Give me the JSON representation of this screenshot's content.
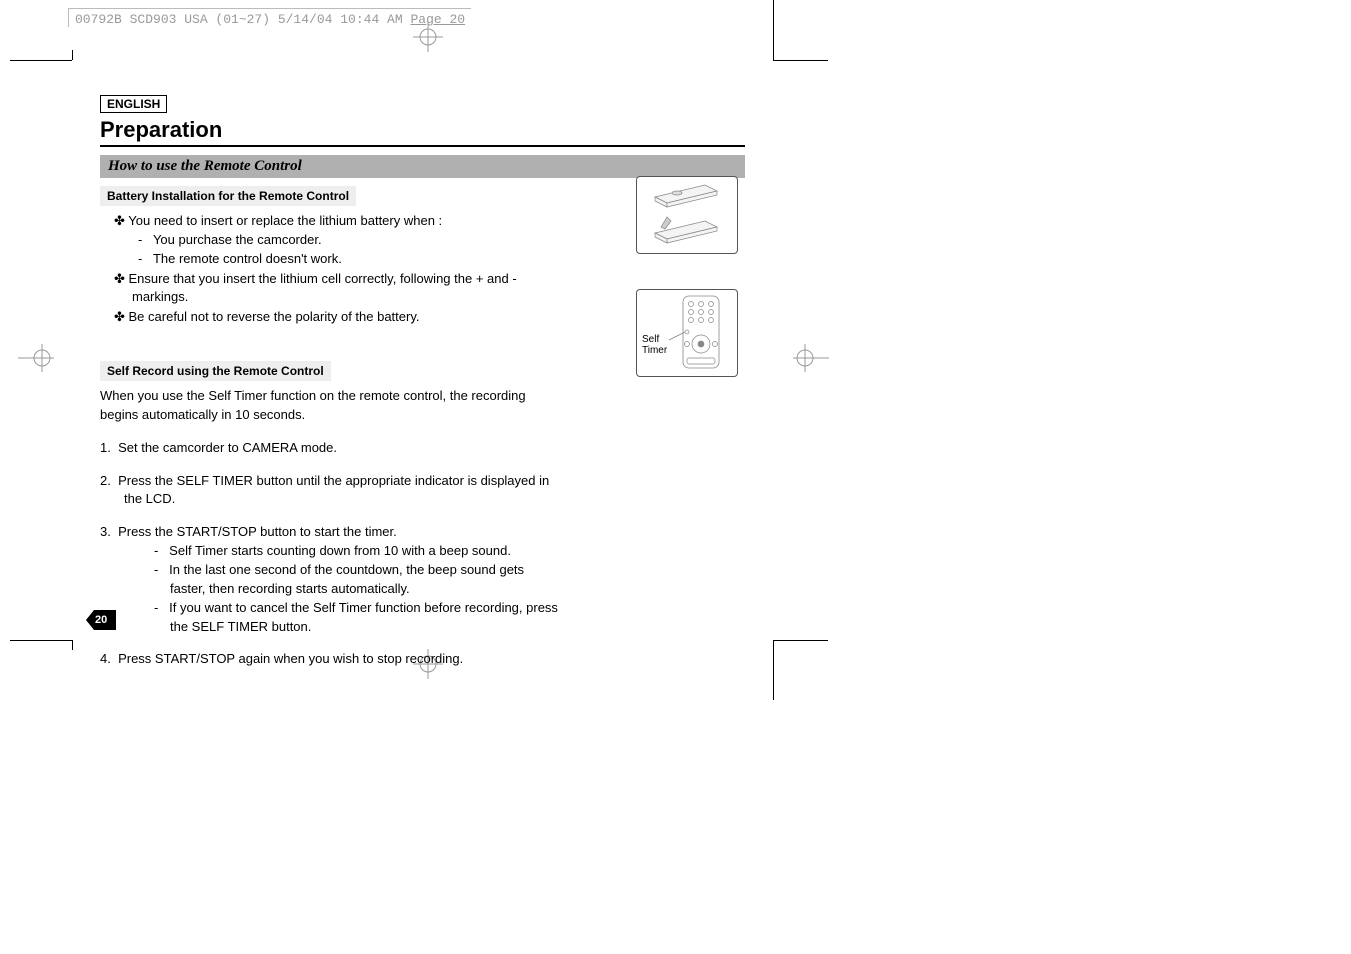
{
  "docHeader": {
    "prefix": "00792B SCD903 USA (01~27)  5/14/04 10:44 AM  ",
    "pageWord": "Page 20"
  },
  "lang": "ENGLISH",
  "title": "Preparation",
  "sectionBar": "How to use the Remote Control",
  "battery": {
    "heading": "Battery Installation for the Remote Control",
    "items": [
      "You need to insert or replace the lithium battery when :",
      "Ensure that you insert the lithium cell correctly, following the + and - markings.",
      "Be careful not to reverse the polarity of the battery."
    ],
    "sub": [
      "You purchase the camcorder.",
      "The remote control doesn't work."
    ]
  },
  "selfRecord": {
    "heading": "Self Record using the Remote Control",
    "intro": "When you use the Self Timer function on the remote control, the recording begins automatically in 10 seconds.",
    "steps": {
      "s1": "Set the camcorder to CAMERA mode.",
      "s2": "Press the SELF TIMER button until the appropriate indicator is displayed in the LCD.",
      "s3": "Press the START/STOP button to start the timer.",
      "s3a": "Self Timer starts counting down from 10 with a beep sound.",
      "s3b": "In the last one second of the countdown, the beep sound gets faster, then recording starts automatically.",
      "s3c": "If you want to cancel the Self Timer function before recording, press the SELF TIMER button.",
      "s4": "Press START/STOP again when you wish to stop recording."
    }
  },
  "figRemoteLabel": "Self\nTimer",
  "pageNumber": "20"
}
